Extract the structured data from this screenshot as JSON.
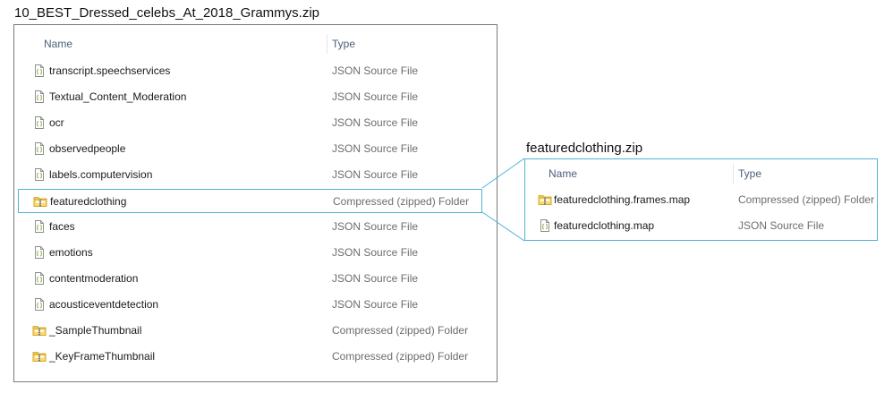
{
  "archive_title": "10_BEST_Dressed_celebs_At_2018_Grammys.zip",
  "columns": {
    "name": "Name",
    "type": "Type"
  },
  "files": [
    {
      "name": "transcript.speechservices",
      "type": "JSON Source File",
      "icon": "json-file-icon"
    },
    {
      "name": "Textual_Content_Moderation",
      "type": "JSON Source File",
      "icon": "json-file-icon"
    },
    {
      "name": "ocr",
      "type": "JSON Source File",
      "icon": "json-file-icon"
    },
    {
      "name": "observedpeople",
      "type": "JSON Source File",
      "icon": "json-file-icon"
    },
    {
      "name": "labels.computervision",
      "type": "JSON Source File",
      "icon": "json-file-icon"
    },
    {
      "name": "featuredclothing",
      "type": "Compressed (zipped) Folder",
      "icon": "zip-folder-icon",
      "selected": true
    },
    {
      "name": "faces",
      "type": "JSON Source File",
      "icon": "json-file-icon"
    },
    {
      "name": "emotions",
      "type": "JSON Source File",
      "icon": "json-file-icon"
    },
    {
      "name": "contentmoderation",
      "type": "JSON Source File",
      "icon": "json-file-icon"
    },
    {
      "name": "acousticeventdetection",
      "type": "JSON Source File",
      "icon": "json-file-icon"
    },
    {
      "name": "_SampleThumbnail",
      "type": "Compressed (zipped) Folder",
      "icon": "zip-folder-icon"
    },
    {
      "name": "_KeyFrameThumbnail",
      "type": "Compressed (zipped) Folder",
      "icon": "zip-folder-icon"
    }
  ],
  "nested_archive": {
    "title": "featuredclothing.zip",
    "files": [
      {
        "name": "featuredclothing.frames.map",
        "type": "Compressed (zipped) Folder",
        "icon": "zip-folder-icon"
      },
      {
        "name": "featuredclothing.map",
        "type": "JSON Source File",
        "icon": "json-file-icon"
      }
    ]
  },
  "colors": {
    "highlight_border": "#4fb3d9",
    "panel_border": "#7a7a7a",
    "header_text": "#4c607a",
    "type_text": "#6d6d6d"
  }
}
